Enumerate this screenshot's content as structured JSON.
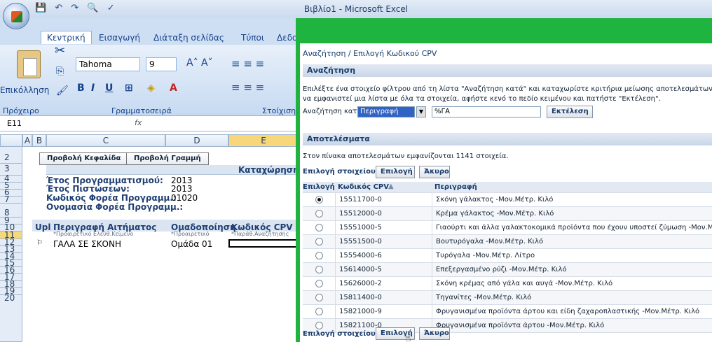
{
  "window": {
    "title": "Βιβλίο1 - Microsoft Excel"
  },
  "ribbon": {
    "tabs": [
      "Κεντρική",
      "Εισαγωγή",
      "Διάταξη σελίδας",
      "Τύποι",
      "Δεδο"
    ],
    "paste_label": "Επικόλληση",
    "font_name": "Tahoma",
    "font_size": "9",
    "groups": [
      "Πρόχειρο",
      "Γραμματοσειρά",
      "Στοίχιση"
    ]
  },
  "formula_bar": {
    "name_box": "E11",
    "fx": "fx"
  },
  "sheet": {
    "columns": [
      "A",
      "B",
      "C",
      "D",
      "E"
    ],
    "rows": [
      "2",
      "3",
      "4",
      "5",
      "6",
      "7",
      "8",
      "9",
      "10",
      "11",
      "12",
      "13",
      "14",
      "15",
      "16",
      "17",
      "18",
      "19",
      "20"
    ],
    "buttons": {
      "show_header": "Προβολή Κεφαλίδα",
      "show_row": "Προβολή Γραμμή"
    },
    "banner": "Καταχώρηση Α",
    "fields": [
      {
        "label": "Έτος Προγραμματισμού:",
        "value": "2013"
      },
      {
        "label": "Έτος Πιστώσεων:",
        "value": "2013"
      },
      {
        "label": "Κωδικός Φορέα Προγραμμ.:",
        "value": "01020"
      },
      {
        "label": "Ονομασία Φορέα Προγραμμ.:",
        "value": ""
      }
    ],
    "table_headers": {
      "upl": "Upl",
      "desc": "Περιγραφή Αιτήματος",
      "group": "Ομαδοποίηση",
      "cpv": "Κωδικός CPV"
    },
    "table_hints": {
      "desc": "*Προαιρετικό Ελεύθ.Κείμενο",
      "group": "*Προαιρετικό",
      "cpv": "*Παράθ.Αναζήτησης"
    },
    "data_row": {
      "upl": "⚐",
      "desc": "ΓΑΛΑ ΣΕ ΣΚΟΝΗ",
      "group": "Ομάδα 01"
    }
  },
  "dialog": {
    "title": "Αναζήτηση / Επιλογή Κωδικού CPV",
    "search_header": "Αναζήτηση",
    "instructions_1": "Επιλέξτε ένα στοιχείο φίλτρου από τη λίστα \"Αναζήτηση κατά\" και καταχωρίστε κριτήρια μείωσης αποτελεσμάτων στο πεδίο",
    "instructions_2": "να εμφανιστεί μια λίστα με όλα τα στοιχεία, αφήστε κενό το πεδίο κειμένου και πατήστε \"Εκτέλεση\".",
    "search_by_label": "Αναζήτηση κατά",
    "search_by_value": "Περιγραφή",
    "search_text": "%ΓΑ",
    "execute_label": "Εκτέλεση",
    "results_header": "Αποτελέσματα",
    "results_count_text": "Στον πίνακα αποτελεσμάτων εμφανίζονται 1141 στοιχεία.",
    "select_item_label": "Επιλογή στοιχείου",
    "select_button": "Επιλογή",
    "cancel_button": "Άκυρο",
    "col_select": "Επιλογή",
    "col_cpv": "Κωδικός CPV",
    "col_desc": "Περιγραφή",
    "rows": [
      {
        "cpv": "15511700-0",
        "desc": "Σκόνη γάλακτος -Μον.Μέτρ. Κιλό",
        "selected": true
      },
      {
        "cpv": "15512000-0",
        "desc": "Κρέμα γάλακτος -Μον.Μέτρ. Κιλό",
        "selected": false
      },
      {
        "cpv": "15551000-5",
        "desc": "Γιαούρτι και άλλα γαλακτοκομικά προϊόντα που έχουν υποστεί ζύμωση -Μον.Μέτρ. Κι",
        "selected": false
      },
      {
        "cpv": "15551500-0",
        "desc": "Βουτυρόγαλα -Μον.Μέτρ. Κιλό",
        "selected": false
      },
      {
        "cpv": "15554000-6",
        "desc": "Τυρόγαλα -Μον.Μέτρ. Λίτρο",
        "selected": false
      },
      {
        "cpv": "15614000-5",
        "desc": "Επεξεργασμένο ρύζι -Μον.Μέτρ. Κιλό",
        "selected": false
      },
      {
        "cpv": "15626000-2",
        "desc": "Σκόνη κρέμας από γάλα και αυγά -Μον.Μέτρ. Κιλό",
        "selected": false
      },
      {
        "cpv": "15811400-0",
        "desc": "Τηγανίτες -Μον.Μέτρ. Κιλό",
        "selected": false
      },
      {
        "cpv": "15821000-9",
        "desc": "Φρυγανισμένα προϊόντα άρτου και είδη ζαχαροπλαστικής -Μον.Μέτρ. Κιλό",
        "selected": false
      },
      {
        "cpv": "15821100-0",
        "desc": "Φρυγανισμένα προϊόντα άρτου -Μον.Μέτρ. Κιλό",
        "selected": false
      }
    ]
  }
}
